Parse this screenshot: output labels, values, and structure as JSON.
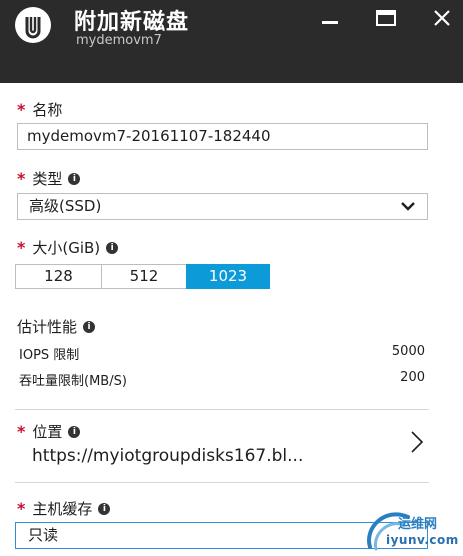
{
  "header": {
    "title": "附加新磁盘",
    "subtitle": "mydemovm7",
    "icon": "disk-icon"
  },
  "window_controls": {
    "minimize": "minimize-icon",
    "maximize": "maximize-icon",
    "close": "close-icon"
  },
  "name_field": {
    "label": "名称",
    "required_mark": "*",
    "value": "mydemovm7-20161107-182440"
  },
  "type_field": {
    "label": "类型",
    "required_mark": "*",
    "info": "i",
    "selected": "高级(SSD)"
  },
  "size_field": {
    "label": "大小(GiB)",
    "required_mark": "*",
    "info": "i",
    "options": [
      "128",
      "512",
      "1023"
    ],
    "selected": "1023"
  },
  "performance": {
    "title": "估计性能",
    "info": "i",
    "rows": [
      {
        "label": "IOPS 限制",
        "value": "5000"
      },
      {
        "label": "吞吐量限制(MB/S)",
        "value": "200"
      }
    ]
  },
  "location_field": {
    "label": "位置",
    "required_mark": "*",
    "info": "i",
    "value": "https://myiotgroupdisks167.bl..."
  },
  "cache_field": {
    "label": "主机缓存",
    "required_mark": "*",
    "info": "i",
    "selected": "只读"
  },
  "watermark": {
    "line1": "运维网",
    "line2": "iyunv.com"
  },
  "colors": {
    "header_bg": "#2b2b2b",
    "accent": "#0c9ad8",
    "required": "#c8102e"
  }
}
